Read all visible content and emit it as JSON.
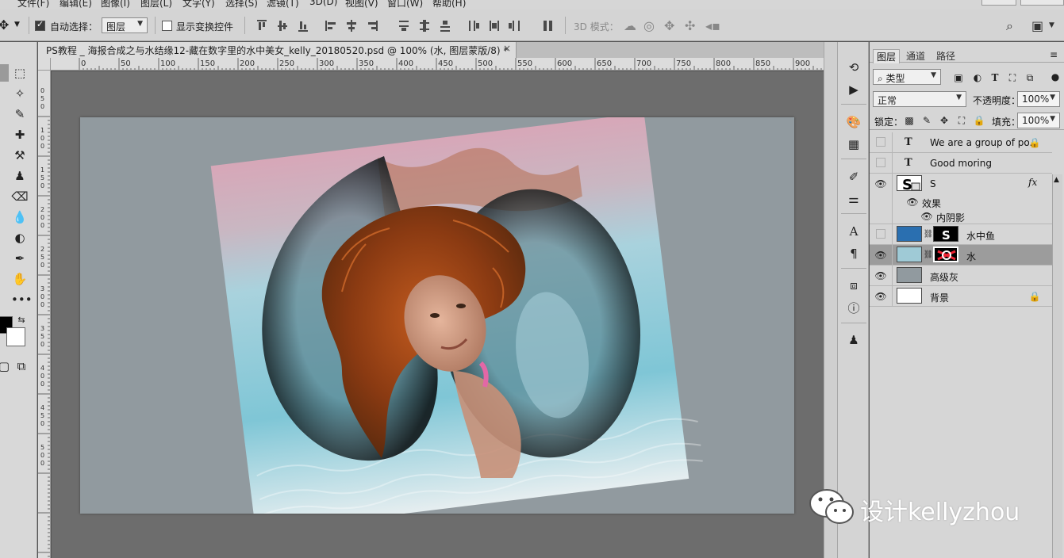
{
  "menu": {
    "items": [
      "文件(F)",
      "编辑(E)",
      "图像(I)",
      "图层(L)",
      "文字(Y)",
      "选择(S)",
      "滤镜(T)",
      "3D(D)",
      "视图(V)",
      "窗口(W)",
      "帮助(H)"
    ]
  },
  "options_bar": {
    "auto_select_label": "自动选择：",
    "auto_select_checked": true,
    "auto_select_target": "图层",
    "show_transform_label": "显示变换控件",
    "show_transform_checked": false,
    "mode_3d_label": "3D 模式："
  },
  "document": {
    "tab_title": "PS教程 _ 海报合成之与水结缘12-藏在数字里的水中美女_kelly_20180520.psd @ 100% (水, 图层蒙版/8) *",
    "close_glyph": "×"
  },
  "rulers": {
    "h_labels": [
      "0",
      "50",
      "100",
      "150",
      "200",
      "250",
      "300",
      "350",
      "400",
      "450",
      "500",
      "550",
      "600",
      "650",
      "700",
      "750",
      "800",
      "850",
      "900"
    ],
    "v_labels": [
      "0",
      "5",
      "0",
      "1",
      "0",
      "0",
      "1",
      "5",
      "0",
      "2",
      "0",
      "0",
      "2",
      "5",
      "0",
      "3",
      "0",
      "0",
      "3",
      "5",
      "0",
      "4",
      "0",
      "0",
      "4",
      "5",
      "0",
      "5",
      "0",
      "0"
    ]
  },
  "panel": {
    "tabs": [
      "图层",
      "通道",
      "路径"
    ],
    "active_tab": "图层",
    "filter_label": "类型",
    "blend_mode": "正常",
    "opacity_label": "不透明度：",
    "opacity_value": "100%",
    "lock_label": "锁定：",
    "fill_label": "填充：",
    "fill_value": "100%"
  },
  "layers": [
    {
      "name": "We are a group of po...",
      "type": "text",
      "visible": false,
      "locked": true
    },
    {
      "name": "Good moring",
      "type": "text",
      "visible": false,
      "locked": false
    },
    {
      "name": "S",
      "type": "smart",
      "visible": true,
      "fx": "fx",
      "effects_label": "效果",
      "effect": "内阴影"
    },
    {
      "name": "水中鱼",
      "type": "smart-mask",
      "visible": false
    },
    {
      "name": "水",
      "type": "smart-mask",
      "visible": true,
      "selected": true
    },
    {
      "name": "高级灰",
      "type": "fill",
      "visible": true,
      "color": "#919a9f"
    },
    {
      "name": "背景",
      "type": "background",
      "visible": true,
      "locked": true,
      "color": "#ffffff"
    }
  ],
  "watermark": {
    "text": "设计kellyzhou"
  },
  "colors": {
    "canvas_gray": "#919a9f",
    "workspace": "#6d6d6d",
    "panel_bg": "#d6d6d6",
    "selected_layer": "#9c9c9c"
  }
}
